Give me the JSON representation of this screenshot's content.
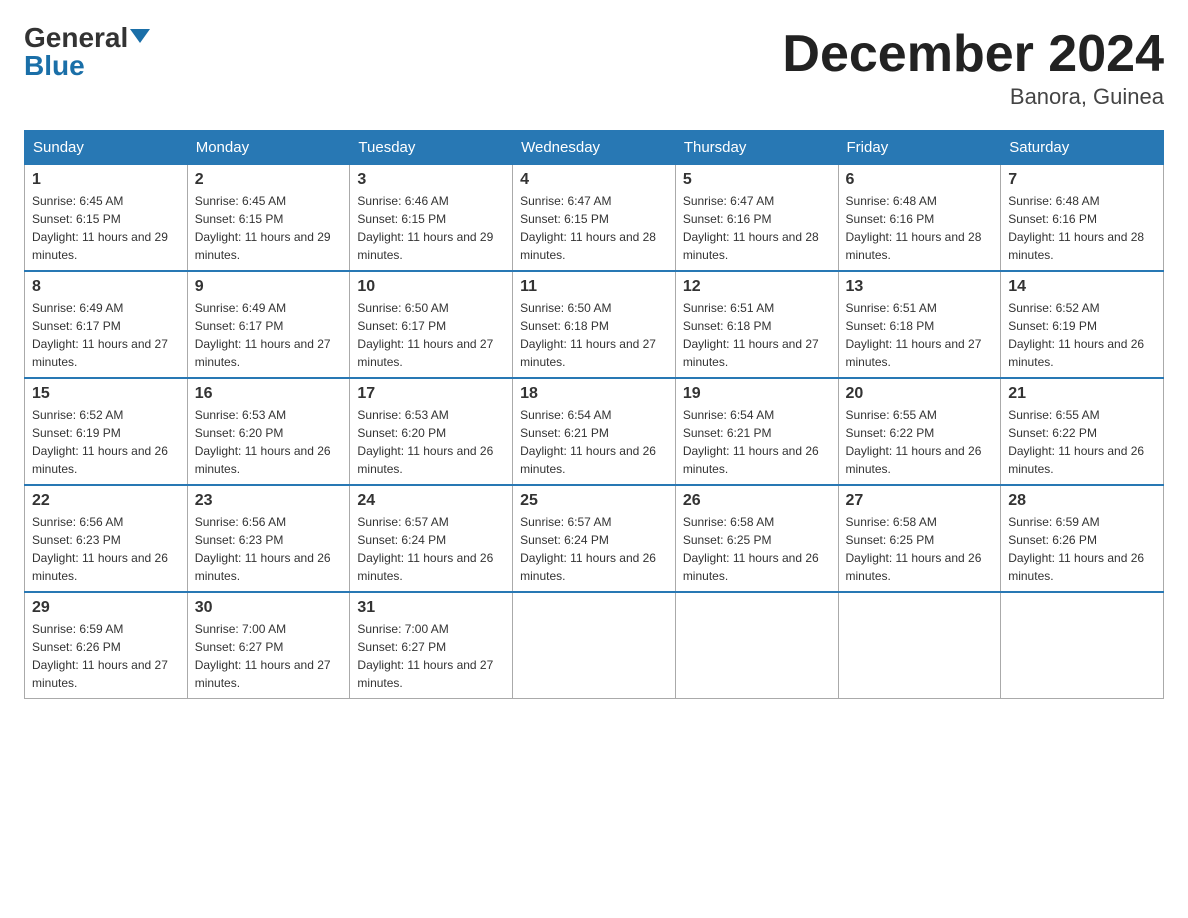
{
  "logo": {
    "general": "General",
    "blue": "Blue"
  },
  "title": "December 2024",
  "location": "Banora, Guinea",
  "days_header": [
    "Sunday",
    "Monday",
    "Tuesday",
    "Wednesday",
    "Thursday",
    "Friday",
    "Saturday"
  ],
  "weeks": [
    [
      {
        "num": "1",
        "sunrise": "6:45 AM",
        "sunset": "6:15 PM",
        "daylight": "11 hours and 29 minutes."
      },
      {
        "num": "2",
        "sunrise": "6:45 AM",
        "sunset": "6:15 PM",
        "daylight": "11 hours and 29 minutes."
      },
      {
        "num": "3",
        "sunrise": "6:46 AM",
        "sunset": "6:15 PM",
        "daylight": "11 hours and 29 minutes."
      },
      {
        "num": "4",
        "sunrise": "6:47 AM",
        "sunset": "6:15 PM",
        "daylight": "11 hours and 28 minutes."
      },
      {
        "num": "5",
        "sunrise": "6:47 AM",
        "sunset": "6:16 PM",
        "daylight": "11 hours and 28 minutes."
      },
      {
        "num": "6",
        "sunrise": "6:48 AM",
        "sunset": "6:16 PM",
        "daylight": "11 hours and 28 minutes."
      },
      {
        "num": "7",
        "sunrise": "6:48 AM",
        "sunset": "6:16 PM",
        "daylight": "11 hours and 28 minutes."
      }
    ],
    [
      {
        "num": "8",
        "sunrise": "6:49 AM",
        "sunset": "6:17 PM",
        "daylight": "11 hours and 27 minutes."
      },
      {
        "num": "9",
        "sunrise": "6:49 AM",
        "sunset": "6:17 PM",
        "daylight": "11 hours and 27 minutes."
      },
      {
        "num": "10",
        "sunrise": "6:50 AM",
        "sunset": "6:17 PM",
        "daylight": "11 hours and 27 minutes."
      },
      {
        "num": "11",
        "sunrise": "6:50 AM",
        "sunset": "6:18 PM",
        "daylight": "11 hours and 27 minutes."
      },
      {
        "num": "12",
        "sunrise": "6:51 AM",
        "sunset": "6:18 PM",
        "daylight": "11 hours and 27 minutes."
      },
      {
        "num": "13",
        "sunrise": "6:51 AM",
        "sunset": "6:18 PM",
        "daylight": "11 hours and 27 minutes."
      },
      {
        "num": "14",
        "sunrise": "6:52 AM",
        "sunset": "6:19 PM",
        "daylight": "11 hours and 26 minutes."
      }
    ],
    [
      {
        "num": "15",
        "sunrise": "6:52 AM",
        "sunset": "6:19 PM",
        "daylight": "11 hours and 26 minutes."
      },
      {
        "num": "16",
        "sunrise": "6:53 AM",
        "sunset": "6:20 PM",
        "daylight": "11 hours and 26 minutes."
      },
      {
        "num": "17",
        "sunrise": "6:53 AM",
        "sunset": "6:20 PM",
        "daylight": "11 hours and 26 minutes."
      },
      {
        "num": "18",
        "sunrise": "6:54 AM",
        "sunset": "6:21 PM",
        "daylight": "11 hours and 26 minutes."
      },
      {
        "num": "19",
        "sunrise": "6:54 AM",
        "sunset": "6:21 PM",
        "daylight": "11 hours and 26 minutes."
      },
      {
        "num": "20",
        "sunrise": "6:55 AM",
        "sunset": "6:22 PM",
        "daylight": "11 hours and 26 minutes."
      },
      {
        "num": "21",
        "sunrise": "6:55 AM",
        "sunset": "6:22 PM",
        "daylight": "11 hours and 26 minutes."
      }
    ],
    [
      {
        "num": "22",
        "sunrise": "6:56 AM",
        "sunset": "6:23 PM",
        "daylight": "11 hours and 26 minutes."
      },
      {
        "num": "23",
        "sunrise": "6:56 AM",
        "sunset": "6:23 PM",
        "daylight": "11 hours and 26 minutes."
      },
      {
        "num": "24",
        "sunrise": "6:57 AM",
        "sunset": "6:24 PM",
        "daylight": "11 hours and 26 minutes."
      },
      {
        "num": "25",
        "sunrise": "6:57 AM",
        "sunset": "6:24 PM",
        "daylight": "11 hours and 26 minutes."
      },
      {
        "num": "26",
        "sunrise": "6:58 AM",
        "sunset": "6:25 PM",
        "daylight": "11 hours and 26 minutes."
      },
      {
        "num": "27",
        "sunrise": "6:58 AM",
        "sunset": "6:25 PM",
        "daylight": "11 hours and 26 minutes."
      },
      {
        "num": "28",
        "sunrise": "6:59 AM",
        "sunset": "6:26 PM",
        "daylight": "11 hours and 26 minutes."
      }
    ],
    [
      {
        "num": "29",
        "sunrise": "6:59 AM",
        "sunset": "6:26 PM",
        "daylight": "11 hours and 27 minutes."
      },
      {
        "num": "30",
        "sunrise": "7:00 AM",
        "sunset": "6:27 PM",
        "daylight": "11 hours and 27 minutes."
      },
      {
        "num": "31",
        "sunrise": "7:00 AM",
        "sunset": "6:27 PM",
        "daylight": "11 hours and 27 minutes."
      },
      null,
      null,
      null,
      null
    ]
  ]
}
